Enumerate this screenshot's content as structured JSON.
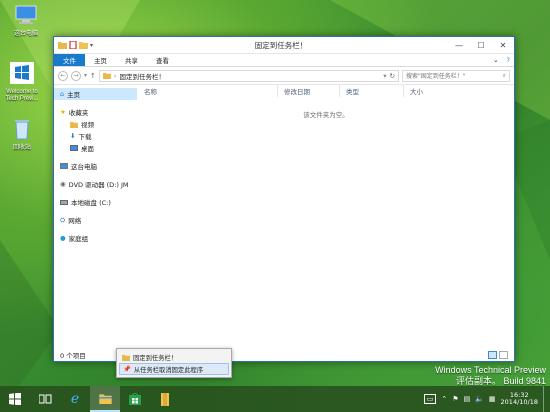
{
  "desktop": {
    "icons": [
      {
        "label": "这台电脑",
        "icon": "computer-icon"
      },
      {
        "label": "Welcome to Tech Previ...",
        "icon": "windows-logo-icon"
      },
      {
        "label": "回收站",
        "icon": "recycle-bin-icon"
      }
    ]
  },
  "window": {
    "title": "固定到任务栏！",
    "ribbon_tabs": [
      "文件",
      "主页",
      "共享",
      "查看"
    ],
    "address": "固定到任务栏！",
    "search_placeholder": "搜索\"固定到任务栏！\"",
    "columns": [
      "名称",
      "修改日期",
      "类型",
      "大小"
    ],
    "empty_message": "该文件夹为空。",
    "status": "0 个项目",
    "nav": [
      {
        "label": "主页",
        "icon": "home-icon",
        "selected": true,
        "level": 0
      },
      {
        "label": "收藏夹",
        "icon": "star-icon",
        "level": 0
      },
      {
        "label": "视频",
        "icon": "folder-icon",
        "level": 1
      },
      {
        "label": "下载",
        "icon": "download-icon",
        "level": 1
      },
      {
        "label": "桌面",
        "icon": "desktop-icon",
        "level": 1
      },
      {
        "label": "这台电脑",
        "icon": "computer-icon",
        "level": 0
      },
      {
        "label": "DVD 驱动器 (D:) JM",
        "icon": "dvd-icon",
        "level": 0
      },
      {
        "label": "本地磁盘 (C:)",
        "icon": "drive-icon",
        "level": 0
      },
      {
        "label": "网络",
        "icon": "network-icon",
        "level": 0
      },
      {
        "label": "家庭组",
        "icon": "homegroup-icon",
        "level": 0
      }
    ]
  },
  "jumplist": {
    "items": [
      {
        "label": "固定到任务栏！",
        "icon": "folder-icon"
      },
      {
        "label": "从任务栏取消固定此程序",
        "icon": "unpin-icon"
      }
    ]
  },
  "watermark": {
    "line1": "Windows Technical Preview",
    "line2": "评估副本。 Build 9841"
  },
  "taskbar": {
    "time": "16:32",
    "date": "2014/10/18",
    "apps": [
      "start",
      "task-view",
      "internet-explorer",
      "file-explorer",
      "store",
      "pinned-folder"
    ]
  },
  "colors": {
    "accent": "#1979ca",
    "taskbar": "#28521e",
    "selection": "#cce8ff"
  }
}
